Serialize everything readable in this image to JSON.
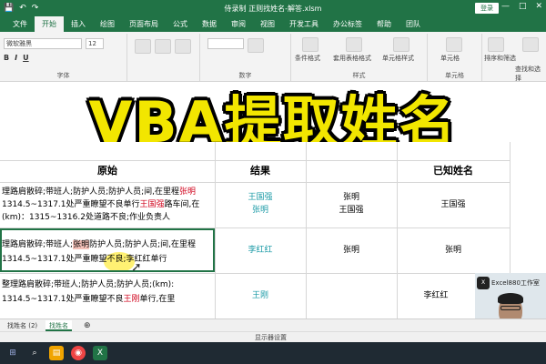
{
  "titlebar": {
    "save_label": "保存",
    "title": "侍录制 正则找姓名-解答.xlsm",
    "login_label": "登录",
    "min_glyph": "—",
    "max_glyph": "□",
    "close_glyph": "✕"
  },
  "tabs": [
    "文件",
    "开始",
    "插入",
    "绘图",
    "页面布局",
    "公式",
    "数据",
    "审阅",
    "视图",
    "开发工具",
    "办公标签",
    "帮助",
    "团队"
  ],
  "active_tab_index": 1,
  "ribbon": {
    "font_name": "微软雅黑",
    "font_size": "12",
    "format_buttons": [
      "B",
      "I",
      "U"
    ],
    "group_font": "字体",
    "group_number": "数字",
    "group_styles": "样式",
    "group_cells": "单元格",
    "conditional_format": "条件格式",
    "table_format": "套用表格格式",
    "cell_styles": "单元格样式",
    "cells_label": "单元格",
    "sort_filter": "排序和筛选",
    "find_select": "查找和选择"
  },
  "overlay_title": "VBA提取姓名",
  "sheet": {
    "headers": {
      "original": "原始",
      "result": "结果",
      "known_names": "已知姓名"
    },
    "rows": [
      {
        "original_line1_a": "理路肩散碎;带班人;防护人员;防护人员;间,在里程",
        "original_line1_name": "张明",
        "original_line2_a": "1314.5~1317.1处严重瞭望不良单行",
        "original_line2_name": "王国强",
        "original_line2_b": "路车间,在",
        "original_line3": "(km)：1315~1316.2处道路不良;作业负责人",
        "result_line1": "王国强",
        "result_line2": "张明",
        "col3_line1": "张明",
        "col3_line2": "王国强",
        "known": "王国强"
      },
      {
        "original_line1_a": "理路肩散碎;带班人;",
        "original_line1_hl": "张明",
        "original_line1_b": "防护人员;防护人员;间,在里程",
        "original_line2": "1314.5~1317.1处严重瞭望不良;李红红单行",
        "result": "李红红",
        "col3": "张明",
        "known": "张明"
      },
      {
        "original_line1": "整理路肩散碎;带班人;防护人员;防护人员;(km):",
        "original_line2_a": "1314.5~1317.1处严重瞭望不良",
        "original_line2_name": "王刚",
        "original_line2_b": "单行,在里",
        "result": "王刚",
        "known": "李红红"
      }
    ]
  },
  "sheet_tabs": [
    "找姓名 (2)",
    "找姓名"
  ],
  "active_sheet_tab": 1,
  "status": {
    "display_settings": "显示器设置"
  },
  "cam": {
    "logo_text": "X",
    "label": "Excel880工作室"
  },
  "colors": {
    "excel_green": "#217346",
    "title_yellow": "#f2e600",
    "name_red": "#d0021b",
    "result_teal": "#1a9aa6"
  }
}
